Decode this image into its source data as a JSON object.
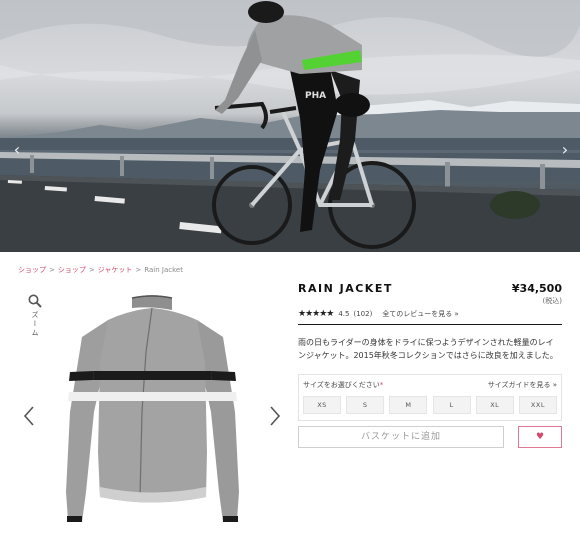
{
  "hero": {
    "prev_glyph": "‹",
    "next_glyph": "›",
    "jersey_text": "PHA"
  },
  "breadcrumb": {
    "items": [
      "ショップ",
      "ショップ",
      "ジャケット"
    ],
    "separator": ">",
    "current": "Rain Jacket"
  },
  "zoom": {
    "icon": "magnifier-icon",
    "label": "ズーム"
  },
  "gallery": {
    "prev_icon": "chevron-left-icon",
    "next_icon": "chevron-right-icon"
  },
  "product": {
    "title": "RAIN JACKET",
    "price": "¥34,500",
    "tax_note": "(税込)",
    "stars": "★★★★★",
    "rating": 4.5,
    "rating_score": "4.5",
    "review_count": "(102)",
    "all_reviews_link": "全てのレビューを見る »",
    "description": "雨の日もライダーの身体をドライに保つようデザインされた軽量のレインジャケット。2015年秋冬コレクションではさらに改良を加えました。"
  },
  "sizes": {
    "prompt": "サイズをお選びください",
    "required_mark": "*",
    "guide_link": "サイズガイドを見る »",
    "options": [
      "XS",
      "S",
      "M",
      "L",
      "XL",
      "XXL"
    ]
  },
  "cart": {
    "add_label": "バスケットに追加",
    "fav_icon": "♥"
  },
  "colors": {
    "accent_pink": "#d04a6c",
    "jacket_grey": "#9e9e9e",
    "stripe_black": "#1b1b1b"
  }
}
